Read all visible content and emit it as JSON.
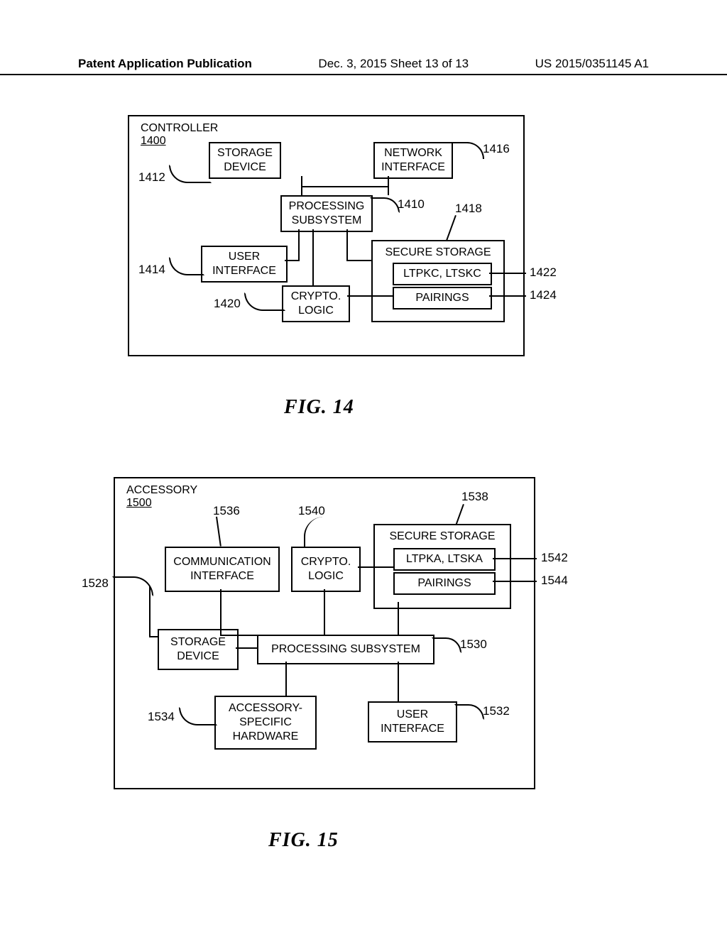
{
  "header": {
    "left": "Patent Application Publication",
    "center": "Dec. 3, 2015  Sheet 13 of 13",
    "right": "US 2015/0351145 A1"
  },
  "fig14": {
    "title": "CONTROLLER",
    "ref": "1400",
    "caption": "FIG. 14",
    "blocks": {
      "storage": "STORAGE\nDEVICE",
      "network": "NETWORK\nINTERFACE",
      "processing": "PROCESSING\nSUBSYSTEM",
      "user_if": "USER\nINTERFACE",
      "secure": "SECURE STORAGE",
      "ltpkc": "LTPKC, LTSKC",
      "pairings": "PAIRINGS",
      "crypto": "CRYPTO.\nLOGIC"
    },
    "refs": {
      "r1416": "1416",
      "r1412": "1412",
      "r1410": "1410",
      "r1418": "1418",
      "r1414": "1414",
      "r1422": "1422",
      "r1424": "1424",
      "r1420": "1420"
    }
  },
  "fig15": {
    "title": "ACCESSORY",
    "ref": "1500",
    "caption": "FIG. 15",
    "blocks": {
      "comm": "COMMUNICATION\nINTERFACE",
      "crypto": "CRYPTO.\nLOGIC",
      "secure": "SECURE STORAGE",
      "ltpka": "LTPKA, LTSKA",
      "pairings": "PAIRINGS",
      "storage": "STORAGE\nDEVICE",
      "processing": "PROCESSING SUBSYSTEM",
      "acc_hw": "ACCESSORY-\nSPECIFIC\nHARDWARE",
      "user_if": "USER\nINTERFACE"
    },
    "refs": {
      "r1538": "1538",
      "r1536": "1536",
      "r1540": "1540",
      "r1528": "1528",
      "r1542": "1542",
      "r1544": "1544",
      "r1530": "1530",
      "r1534": "1534",
      "r1532": "1532"
    }
  }
}
